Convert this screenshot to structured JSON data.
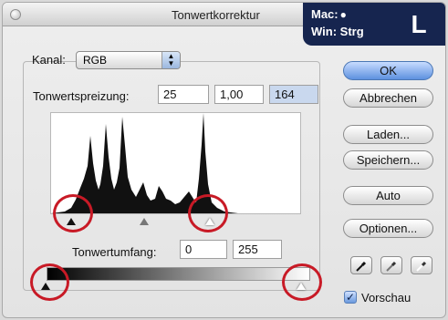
{
  "window": {
    "title": "Tonwertkorrektur"
  },
  "shortcut": {
    "mac": "Mac:",
    "win": "Win:  Strg",
    "key": "L",
    "apple_icon": "apple-icon"
  },
  "channel": {
    "label": "Kanal:",
    "value": "RGB"
  },
  "input_levels": {
    "label": "Tonwertspreizung:",
    "black": "25",
    "gamma": "1,00",
    "white": "164"
  },
  "output_levels": {
    "label": "Tonwertumfang:",
    "black": "0",
    "white": "255"
  },
  "buttons": {
    "ok": "OK",
    "cancel": "Abbrechen",
    "load": "Laden...",
    "save": "Speichern...",
    "auto": "Auto",
    "options": "Optionen..."
  },
  "preview": {
    "label": "Vorschau",
    "checked": true
  },
  "colors": {
    "accent": "#5d91df",
    "highlight_ring": "#c81a26",
    "shortcut_bg": "#16254f"
  }
}
